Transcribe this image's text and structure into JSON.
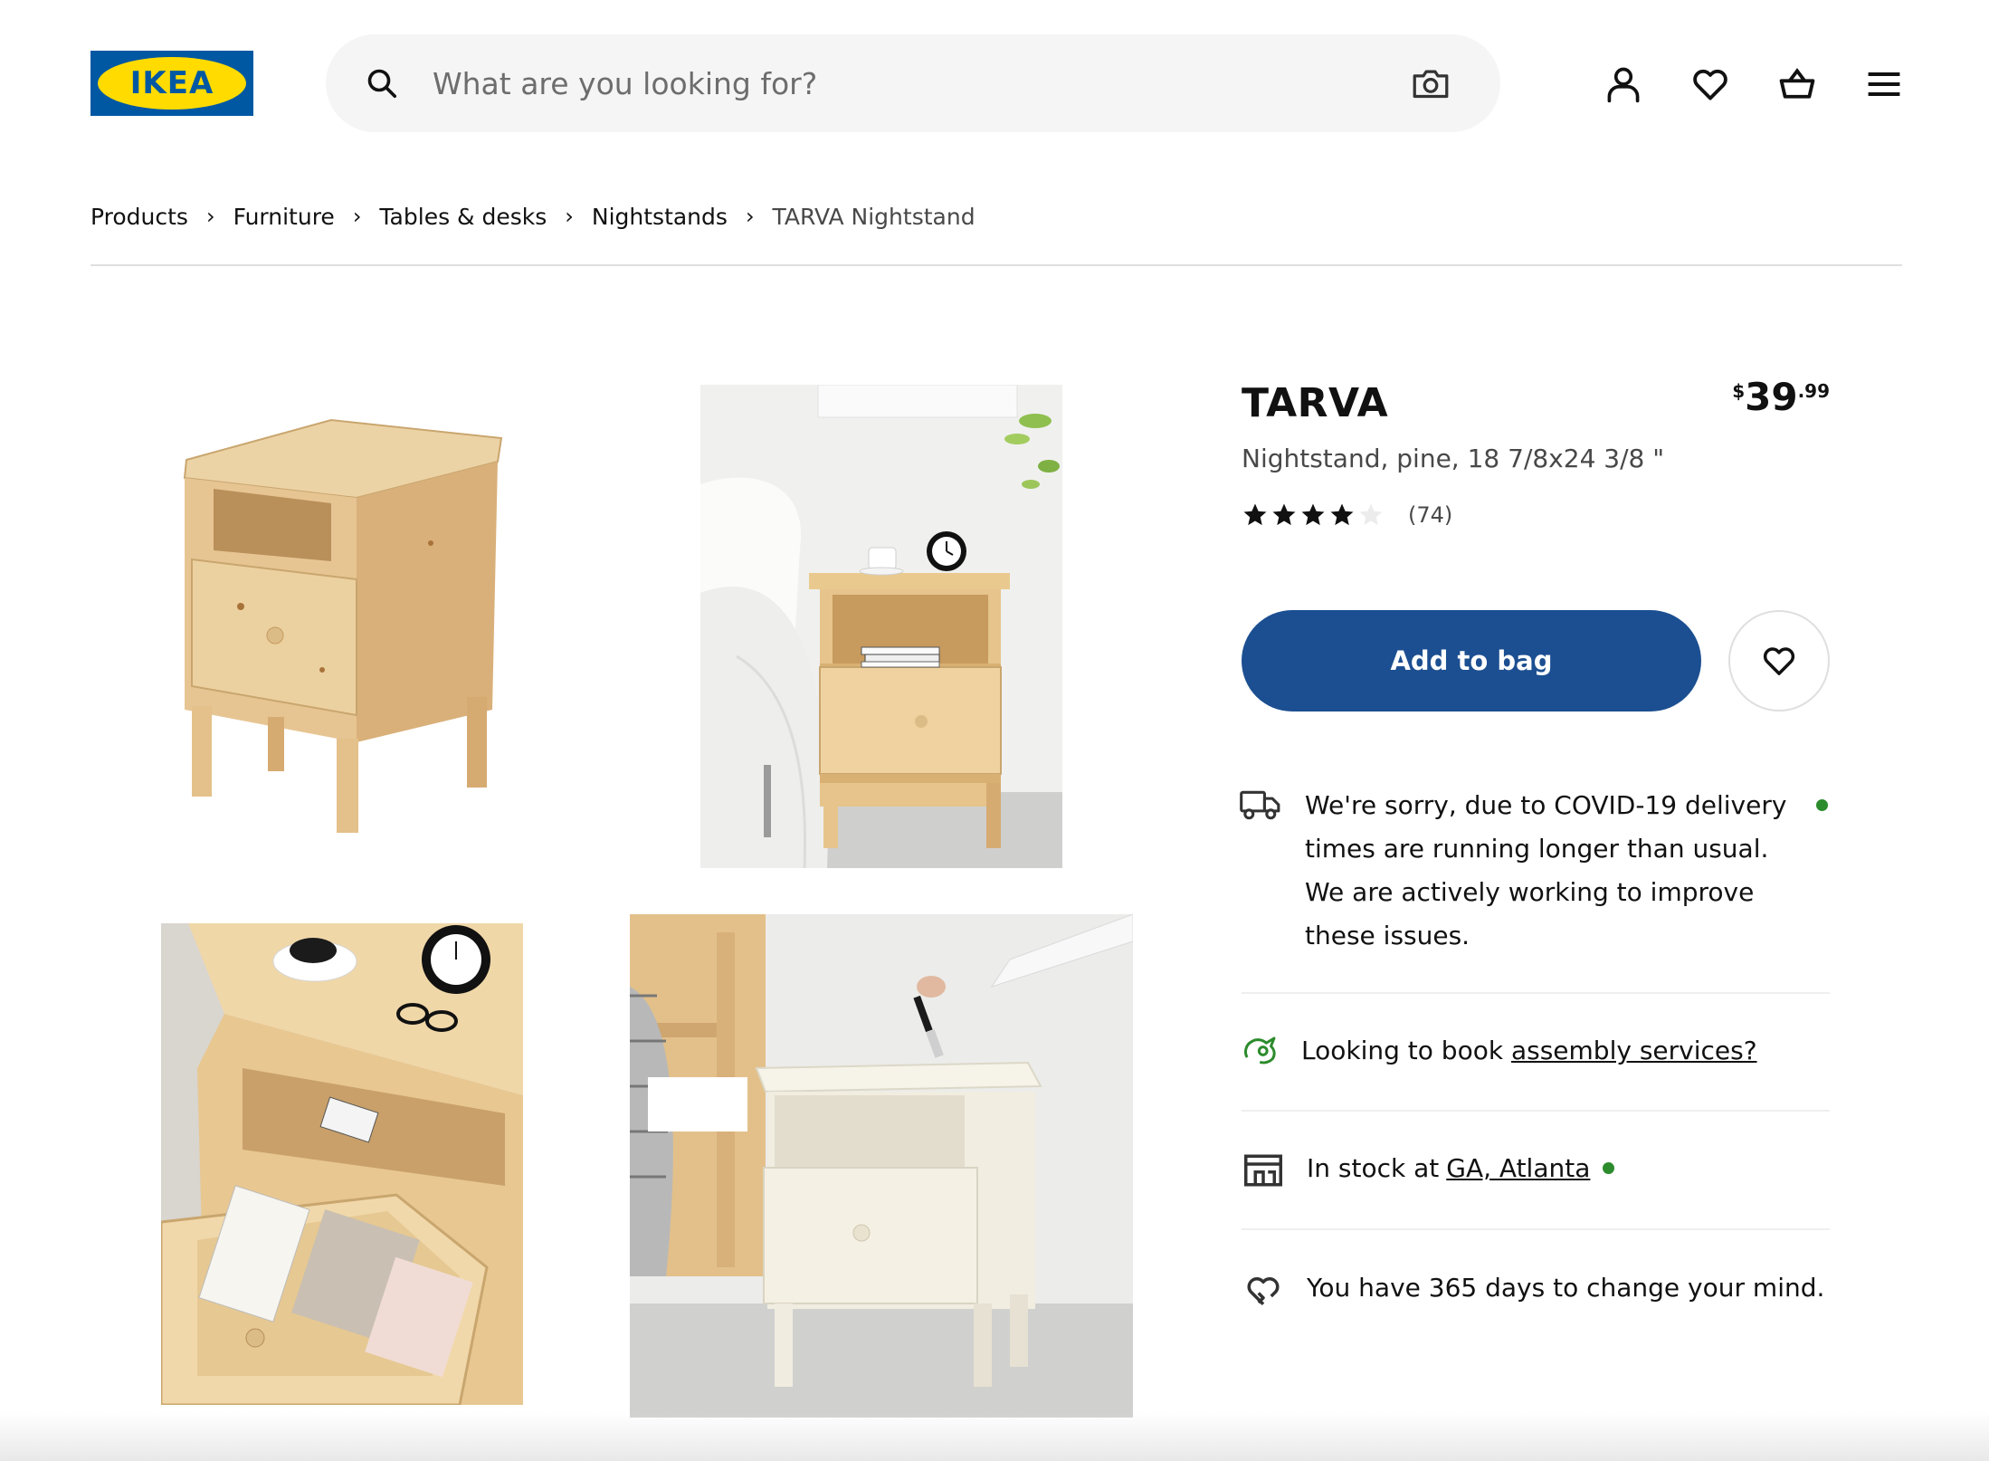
{
  "header": {
    "logo_text": "IKEA",
    "search_placeholder": "What are you looking for?",
    "icons": [
      "user-icon",
      "heart-icon",
      "basket-icon",
      "menu-icon"
    ]
  },
  "breadcrumb": {
    "items": [
      "Products",
      "Furniture",
      "Tables & desks",
      "Nightstands"
    ],
    "current": "TARVA Nightstand"
  },
  "product": {
    "name": "TARVA",
    "price_currency": "$",
    "price_int": "39",
    "price_dec": ".99",
    "description": "Nightstand, pine, 18 7/8x24 3/8 \"",
    "rating": 4,
    "rating_max": 5,
    "review_count": "(74)"
  },
  "actions": {
    "add_to_bag": "Add to bag"
  },
  "info": {
    "covid": "We're sorry, due to COVID-19 delivery times are running longer than usual. We are actively working to improve these issues.",
    "assembly_prefix": "Looking to book ",
    "assembly_link": "assembly services?",
    "stock_prefix": "In stock at",
    "stock_link": "GA, Atlanta",
    "return_policy": "You have 365 days to change your mind."
  },
  "colors": {
    "brand_blue": "#0058a3",
    "button_blue": "#1c4f91",
    "brand_yellow": "#ffdb00",
    "status_green": "#2c8b2c"
  }
}
